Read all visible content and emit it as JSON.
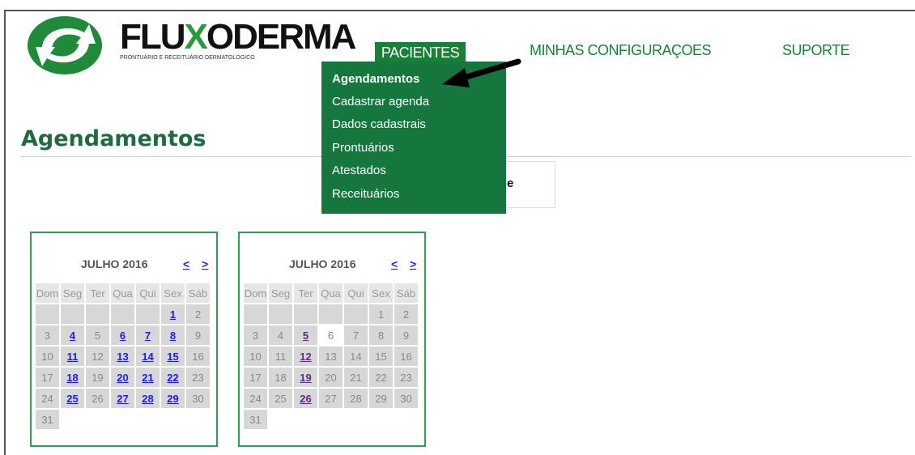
{
  "logo": {
    "text_black1": "FLU",
    "text_green": "X",
    "text_black2": "O",
    "text_black3": "DERMA",
    "tagline": "PRONTUÁRIO E RECEITUÁRIO DERMATOLÓGICO"
  },
  "nav": {
    "pacientes": "PACIENTES",
    "configuracoes": "MINHAS CONFIGURAÇOES",
    "suporte": "SUPORTE"
  },
  "dropdown": [
    "Agendamentos",
    "Cadastrar agenda",
    "Dados cadastrais",
    "Prontuários",
    "Atestados",
    "Receituários"
  ],
  "page_title": "Agendamentos",
  "box_fragment": "e",
  "colors": {
    "brand_green": "#178235",
    "menu_green": "#15773d",
    "calendar_border": "#2aa34d",
    "link_blue": "#1a1aff",
    "visited_purple": "#5a2d82"
  },
  "calendars": [
    {
      "month": "JULHO 2016",
      "prev": "<",
      "next": ">",
      "weekdays": [
        "Dom",
        "Seg",
        "Ter",
        "Qua",
        "Qui",
        "Sex",
        "Sáb"
      ],
      "weeks": [
        [
          "",
          "",
          "",
          "",
          "",
          "1",
          "2"
        ],
        [
          "3",
          "4",
          "5",
          "6",
          "7",
          "8",
          "9"
        ],
        [
          "10",
          "11",
          "12",
          "13",
          "14",
          "15",
          "16"
        ],
        [
          "17",
          "18",
          "19",
          "20",
          "21",
          "22",
          "23"
        ],
        [
          "24",
          "25",
          "26",
          "27",
          "28",
          "29",
          "30"
        ],
        [
          "31"
        ]
      ],
      "linked_days": [
        "1",
        "4",
        "6",
        "7",
        "8",
        "11",
        "13",
        "14",
        "15",
        "18",
        "20",
        "21",
        "22",
        "25",
        "27",
        "28",
        "29"
      ],
      "visited_days": [],
      "today": ""
    },
    {
      "month": "JULHO 2016",
      "prev": "<",
      "next": ">",
      "weekdays": [
        "Dom",
        "Seg",
        "Ter",
        "Qua",
        "Qui",
        "Sex",
        "Sáb"
      ],
      "weeks": [
        [
          "",
          "",
          "",
          "",
          "",
          "1",
          "2"
        ],
        [
          "3",
          "4",
          "5",
          "6",
          "7",
          "8",
          "9"
        ],
        [
          "10",
          "11",
          "12",
          "13",
          "14",
          "15",
          "16"
        ],
        [
          "17",
          "18",
          "19",
          "20",
          "21",
          "22",
          "23"
        ],
        [
          "24",
          "25",
          "26",
          "27",
          "28",
          "29",
          "30"
        ],
        [
          "31"
        ]
      ],
      "linked_days": [],
      "visited_days": [
        "5",
        "12",
        "19",
        "26"
      ],
      "today": "6"
    }
  ]
}
